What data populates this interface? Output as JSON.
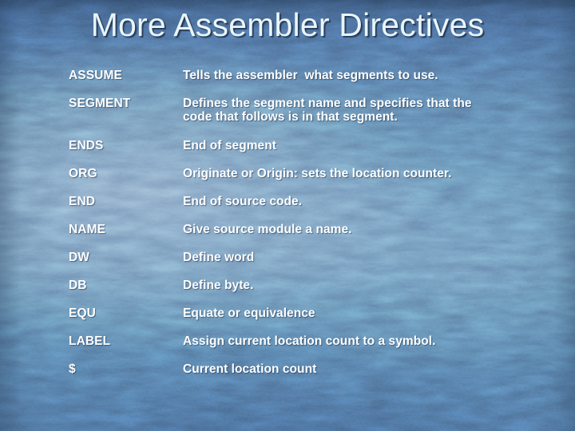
{
  "slide": {
    "title": "More Assembler Directives",
    "background_color": "#5a7da4",
    "title_color": "#e9f5f9",
    "text_color": "#ffffff"
  },
  "directives": [
    {
      "term": "ASSUME",
      "definition": "Tells the assembler  what segments to use."
    },
    {
      "term": "SEGMENT",
      "definition": "Defines the segment name and specifies that the",
      "definition_line2": "code that follows is in that segment."
    },
    {
      "term": "ENDS",
      "definition": "End of segment"
    },
    {
      "term": "ORG",
      "definition": "Originate or Origin: sets the location counter."
    },
    {
      "term": "END",
      "definition": "End of source code."
    },
    {
      "term": "NAME",
      "definition": "Give source module a name."
    },
    {
      "term": "DW",
      "definition": "Define word"
    },
    {
      "term": "DB",
      "definition": "Define byte."
    },
    {
      "term": "EQU",
      "definition": "Equate or equivalence"
    },
    {
      "term": "LABEL",
      "definition": "Assign current location count to a symbol."
    },
    {
      "term": "$",
      "definition": "Current location count"
    }
  ]
}
